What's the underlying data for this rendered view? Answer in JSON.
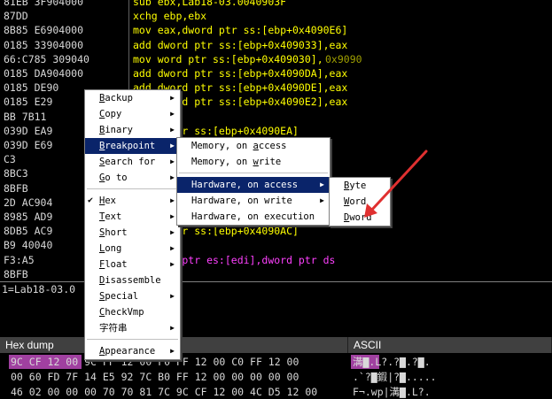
{
  "colors": {
    "address_bg": "#000000",
    "bytes_text": "#d8d8d8",
    "asm_yellow": "#ffff00",
    "asm_olive": "#a0a000",
    "asm_pink": "#ff40ff",
    "menu_highlight": "#0a246a",
    "arrow_red": "#e03030"
  },
  "disasm_rows": [
    {
      "bytes": "81EB 3F904000",
      "asm": "sub ebx,Lab18-03.0040903F",
      "color": "#ffff00"
    },
    {
      "bytes": "87DD",
      "asm": "xchg ebp,ebx",
      "color": "#ffff00"
    },
    {
      "bytes": "8B85 E6904000",
      "asm": "mov eax,dword ptr ss:[ebp+0x4090E6]",
      "color": "#ffff00"
    },
    {
      "bytes": "0185 33904000",
      "asm": "add dword ptr ss:[ebp+0x409033],eax",
      "color": "#ffff00"
    },
    {
      "bytes": "66:C785 309040",
      "asm": "mov word ptr ss:[ebp+0x409030],",
      "asm2": "0x9090",
      "color": "#ffff00"
    },
    {
      "bytes": "0185 DA904000",
      "asm": "add dword ptr ss:[ebp+0x4090DA],eax",
      "color": "#ffff00"
    },
    {
      "bytes": "0185 DE90",
      "asm": "add dword ptr ss:[ebp+0x4090DE],eax",
      "color": "#ffff00"
    },
    {
      "bytes": "0185 E29",
      "asm": "add dword ptr ss:[ebp+0x4090E2],eax",
      "color": "#ffff00"
    },
    {
      "bytes": "BB 7B11",
      "asm": "x,0x117B",
      "color": "#a0a000"
    },
    {
      "bytes": "039D EA9",
      "asm": "dword ptr ss:[ebp+0x4090EA]",
      "color": "#ffff00"
    },
    {
      "bytes": "039D E69",
      "asm": "dword ptr ss:[ebp+0x4090E6]",
      "color": "#ffff00"
    },
    {
      "bytes": "C3",
      "asm": "",
      "color": "#ffff00"
    },
    {
      "bytes": "8BC3",
      "asm": "",
      "color": "#ffff00"
    },
    {
      "bytes": "8BFB",
      "asm": "",
      "color": "#ffff00"
    },
    {
      "bytes": "2D AC904",
      "asm": "",
      "color": "#ffff00"
    },
    {
      "bytes": "8985 AD9",
      "asm": "",
      "color": "#ffff00"
    },
    {
      "bytes": "8DB5 AC9",
      "asm": "dword ptr ss:[ebp+0x4090AC]",
      "color": "#ffff00"
    },
    {
      "bytes": "B9 40040",
      "asm": "x,0x440",
      "color": "#a0a000"
    },
    {
      "bytes": "F3:A5",
      "asm": "s dword ptr es:[edi],dword ptr ds",
      "color": "#ff40ff"
    },
    {
      "bytes": "8BFB",
      "asm": ",ebx",
      "color": "#ffff00"
    }
  ],
  "info_text": "1=Lab18-03.0",
  "dump": {
    "headers": [
      "Hex dump",
      "ASCII"
    ],
    "rows": [
      {
        "hex": "9C CF 12 00 9C FF 12 00 F0 FF 12 00 C0 FF 12 00",
        "ascii": "溝▇.L?.?▇.?▇."
      },
      {
        "hex": "00 60 FD 7F 14 E5 92 7C B0 FF 12 00 00 00 00 00",
        "ascii": ".`?▇鍜|?▇....."
      },
      {
        "hex": "46 02 00 00 00 70 70 81 7C 9C CF 12 00 4C D5 12 00",
        "ascii": "F¬.wp|溝▇.L?."
      }
    ]
  },
  "main_menu": {
    "items": [
      {
        "label": "Backup",
        "key": "B",
        "rest": "ackup",
        "arrow": true
      },
      {
        "label": "Copy",
        "key": "C",
        "rest": "opy",
        "arrow": true
      },
      {
        "label": "Binary",
        "key": "B",
        "rest": "inary",
        "arrow": true
      },
      {
        "label": "Breakpoint",
        "key": "B",
        "rest": "reakpoint",
        "arrow": true,
        "selected": true
      },
      {
        "label": "Search for",
        "key": "S",
        "rest": "earch for",
        "arrow": true
      },
      {
        "label": "Go to",
        "key": "G",
        "rest": "o to",
        "arrow": true
      },
      {
        "sep": true
      },
      {
        "label": "Hex",
        "key": "H",
        "rest": "ex",
        "arrow": true,
        "check": true
      },
      {
        "label": "Text",
        "key": "T",
        "rest": "ext",
        "arrow": true
      },
      {
        "label": "Short",
        "key": "S",
        "rest": "hort",
        "arrow": true
      },
      {
        "label": "Long",
        "key": "L",
        "rest": "ong",
        "arrow": true
      },
      {
        "label": "Float",
        "key": "F",
        "rest": "loat",
        "arrow": true
      },
      {
        "label": "Disassemble",
        "key": "D",
        "rest": "isassemble",
        "arrow": false
      },
      {
        "label": "Special",
        "key": "S",
        "rest": "pecial",
        "arrow": true
      },
      {
        "label": "CheckVmp",
        "key": "C",
        "rest": "heckVmp",
        "arrow": false
      },
      {
        "label": "字符串",
        "key": "",
        "rest": "字符串",
        "arrow": true
      },
      {
        "sep": true
      },
      {
        "label": "Appearance",
        "key": "A",
        "rest": "ppearance",
        "arrow": true
      }
    ]
  },
  "breakpoint_menu": {
    "items": [
      {
        "label": "Memory, on access",
        "pre": "Memory, on ",
        "key": "a",
        "rest": "ccess"
      },
      {
        "label": "Memory, on write",
        "pre": "Memory, on ",
        "key": "w",
        "rest": "rite"
      },
      {
        "sep": true
      },
      {
        "label": "Hardware, on access",
        "pre": "Hardware, on access",
        "key": "",
        "rest": "",
        "arrow": true,
        "selected": true
      },
      {
        "label": "Hardware, on write",
        "pre": "Hardware, on write",
        "key": "",
        "rest": "",
        "arrow": true
      },
      {
        "label": "Hardware, on execution",
        "pre": "Hardware, on execution",
        "key": "",
        "rest": ""
      }
    ]
  },
  "hw_access_menu": {
    "items": [
      {
        "label": "Byte",
        "key": "B",
        "rest": "yte"
      },
      {
        "label": "Word",
        "key": "W",
        "rest": "ord"
      },
      {
        "label": "Dword",
        "key": "D",
        "rest": "word"
      }
    ]
  }
}
